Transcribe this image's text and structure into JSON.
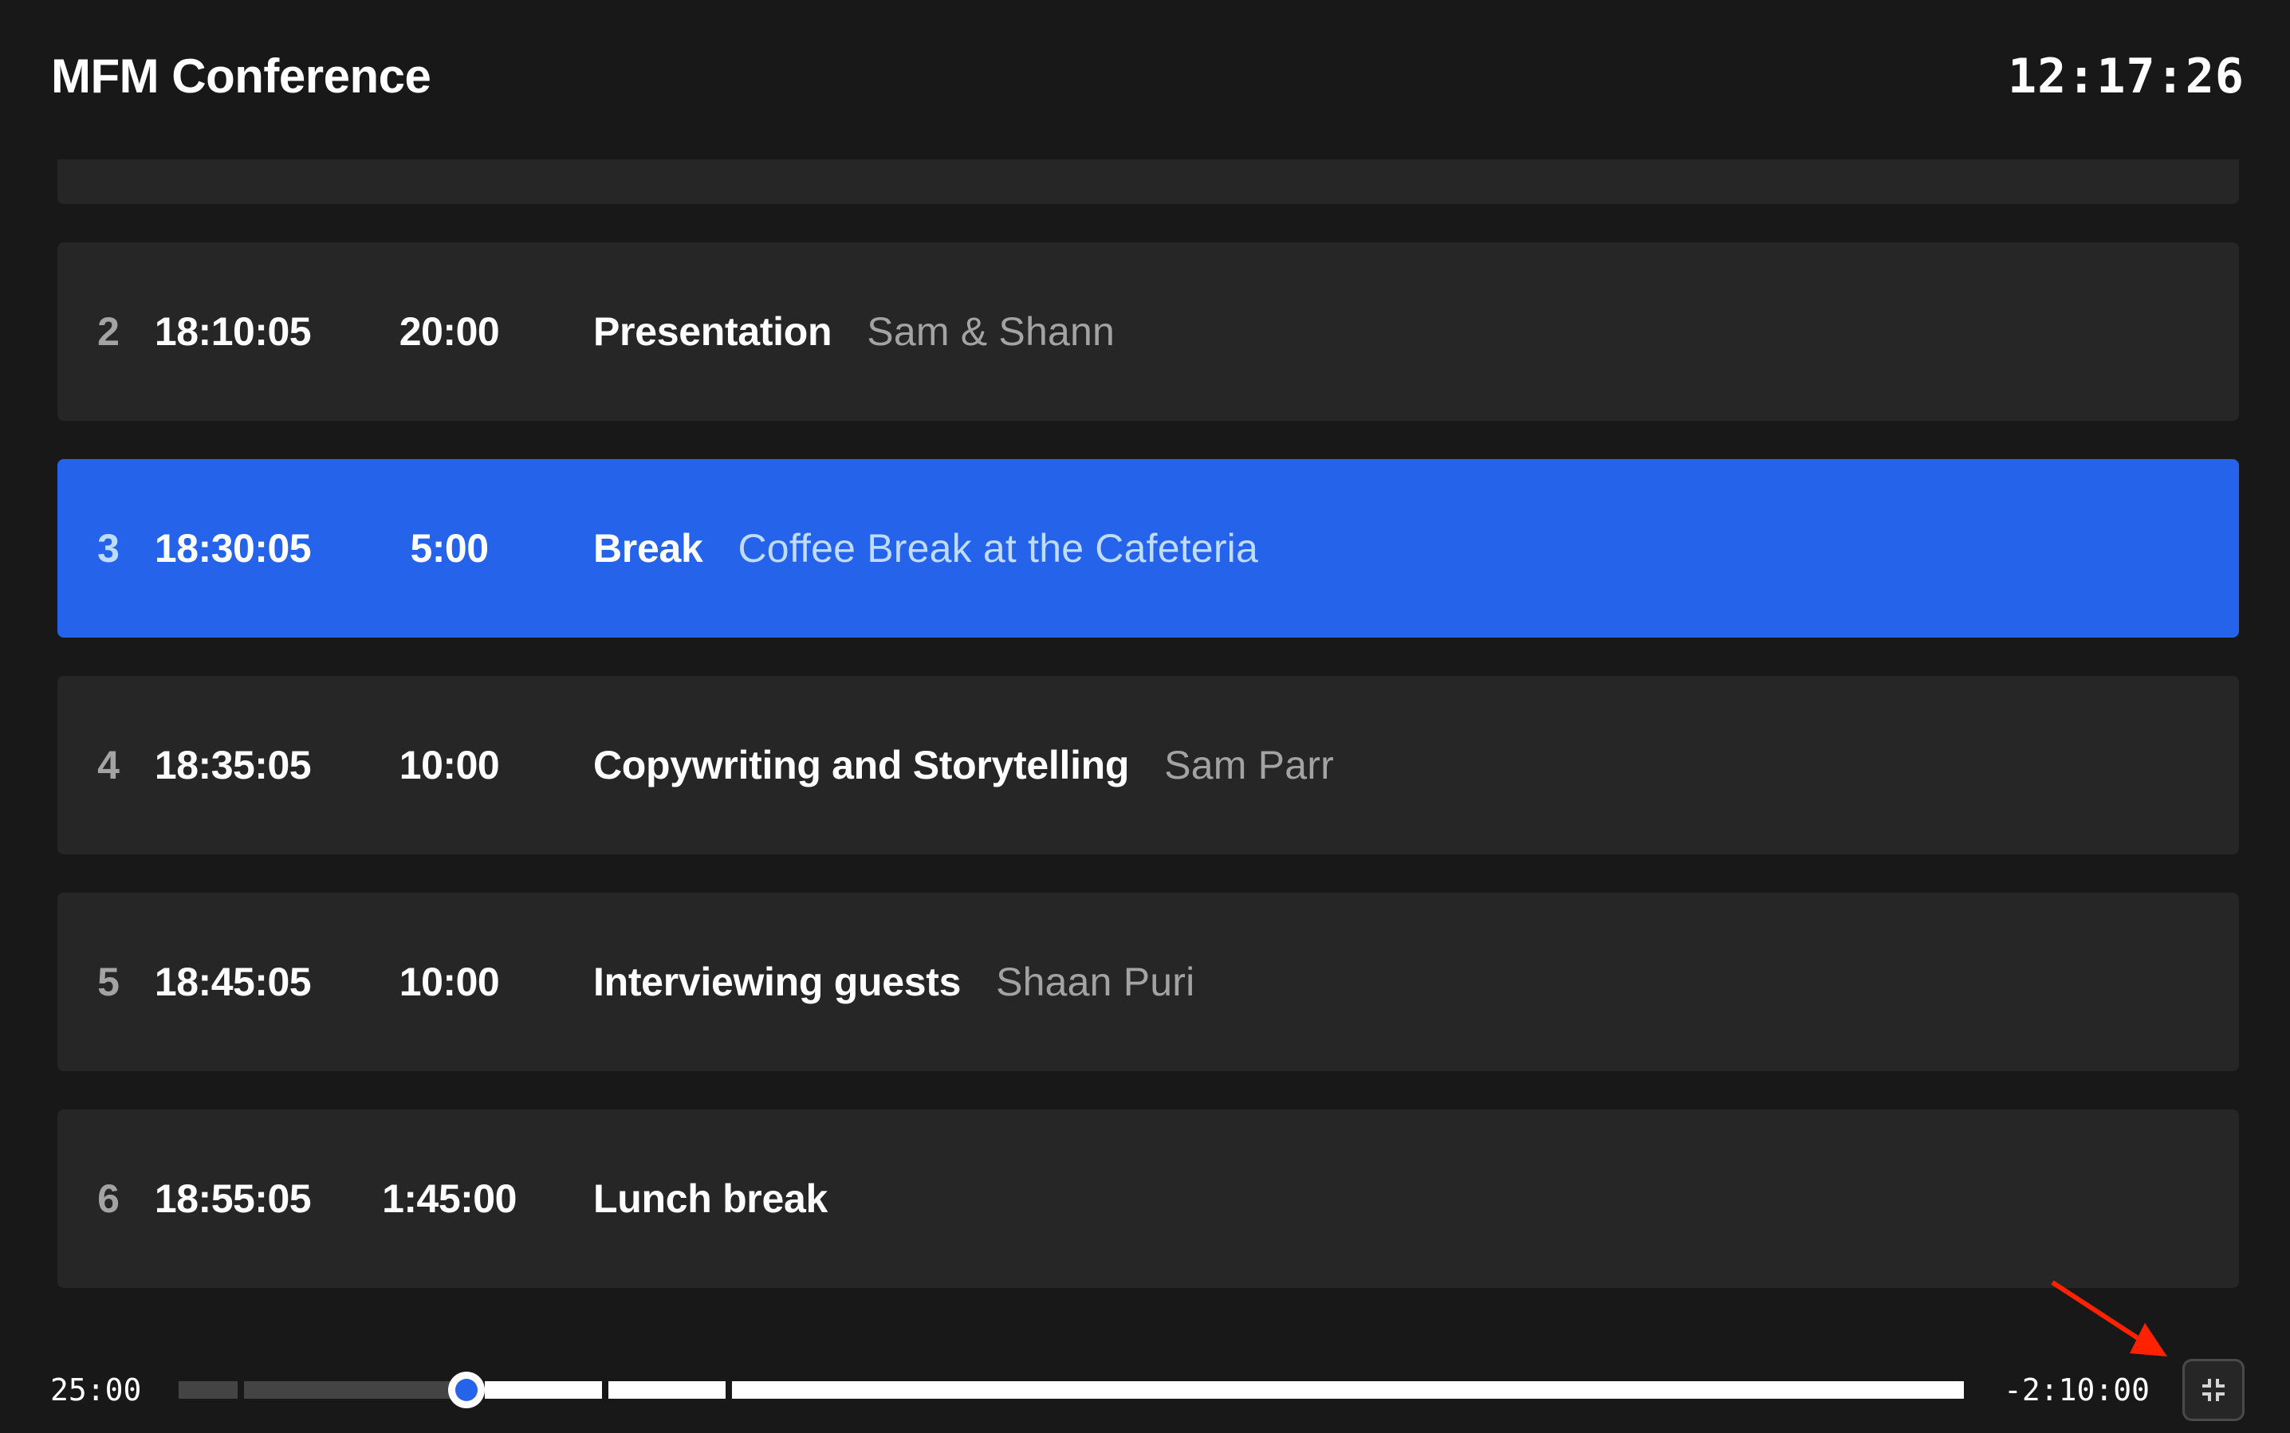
{
  "header": {
    "title": "MFM Conference",
    "clock": "12:17:26"
  },
  "events": [
    {
      "index": "2",
      "start": "18:10:05",
      "duration": "20:00",
      "title": "Presentation",
      "subtitle": "Sam & Shann",
      "active": false
    },
    {
      "index": "3",
      "start": "18:30:05",
      "duration": "5:00",
      "title": "Break",
      "subtitle": "Coffee Break at the Cafeteria",
      "active": true
    },
    {
      "index": "4",
      "start": "18:35:05",
      "duration": "10:00",
      "title": "Copywriting and Storytelling",
      "subtitle": "Sam Parr",
      "active": false
    },
    {
      "index": "5",
      "start": "18:45:05",
      "duration": "10:00",
      "title": "Interviewing guests",
      "subtitle": "Shaan Puri",
      "active": false
    },
    {
      "index": "6",
      "start": "18:55:05",
      "duration": "1:45:00",
      "title": "Lunch break",
      "subtitle": "",
      "active": false
    }
  ],
  "footer": {
    "elapsed": "25:00",
    "remaining": "-2:10:00",
    "progress_segments_minutes": [
      5,
      20,
      10,
      10,
      105
    ],
    "progress_fraction": 0.16,
    "fullscreen_button_icon": "exit-fullscreen-icon"
  },
  "colors": {
    "background": "#181818",
    "card": "#262626",
    "active": "#2563eb",
    "muted_text": "#a3a3a3",
    "active_muted_text": "#bfdbfe",
    "annotation_arrow": "#ff2200"
  }
}
